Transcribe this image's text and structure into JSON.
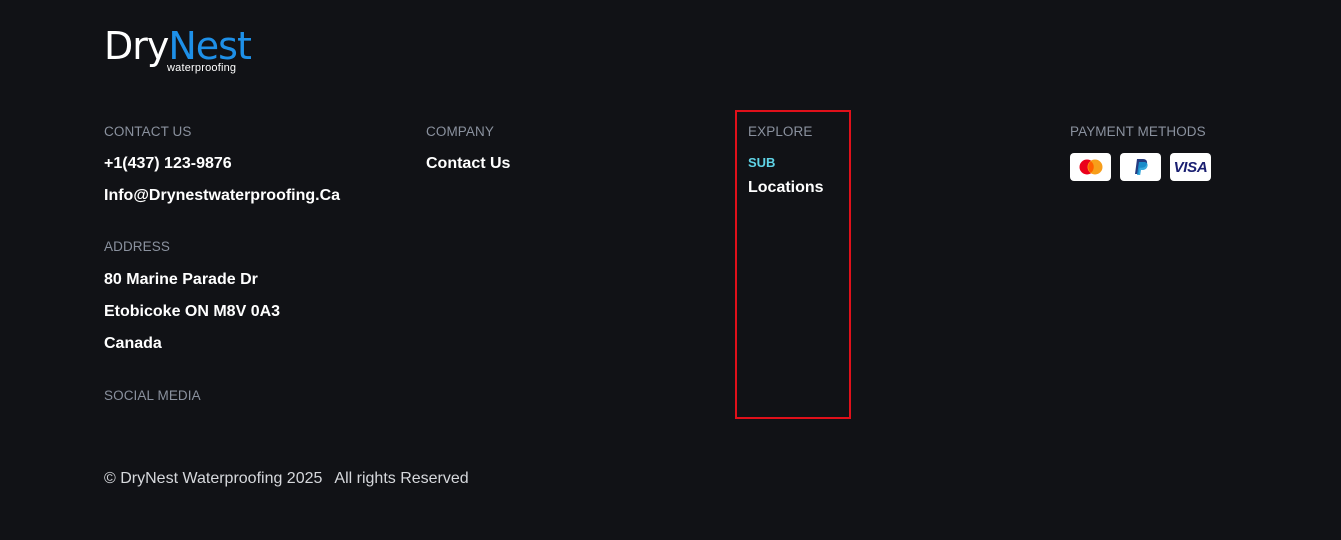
{
  "brand": {
    "name_part1": "Dry",
    "name_part2": "Nest",
    "tagline": "waterproofing",
    "accent_color": "#1e90e8"
  },
  "contact": {
    "heading": "CONTACT US",
    "phone": "+1(437) 123-9876",
    "email": "Info@Drynestwaterproofing.Ca"
  },
  "address": {
    "heading": "ADDRESS",
    "line1": "80 Marine Parade Dr",
    "line2": "Etobicoke ON M8V 0A3",
    "line3": "Canada"
  },
  "social": {
    "heading": "SOCIAL MEDIA"
  },
  "company": {
    "heading": "COMPANY",
    "links": [
      "Contact Us"
    ]
  },
  "explore": {
    "heading": "EXPLORE",
    "sub_label": "SUB",
    "links": [
      "Locations"
    ],
    "highlight_color": "#e0101a"
  },
  "payment": {
    "heading": "PAYMENT METHODS",
    "methods": [
      {
        "icon": "mastercard-icon"
      },
      {
        "icon": "paypal-icon"
      },
      {
        "icon": "visa-icon",
        "label": "VISA"
      }
    ]
  },
  "footer": {
    "copyright": "© DryNest Waterproofing 2025",
    "rights": "All rights Reserved"
  }
}
